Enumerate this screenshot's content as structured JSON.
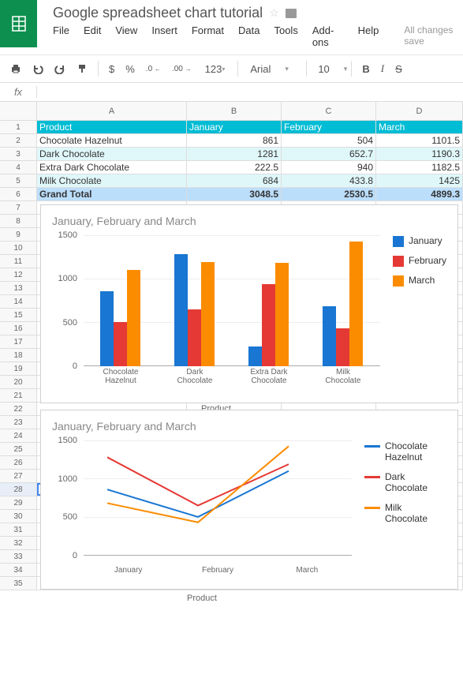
{
  "doc": {
    "title": "Google spreadsheet chart tutorial"
  },
  "menubar": {
    "file": "File",
    "edit": "Edit",
    "view": "View",
    "insert": "Insert",
    "format": "Format",
    "data": "Data",
    "tools": "Tools",
    "addons": "Add-ons",
    "help": "Help",
    "saved": "All changes save"
  },
  "toolbar": {
    "currency": "$",
    "percent": "%",
    "dec_down": ".0",
    "dec_up": ".00",
    "more_formats": "123",
    "font": "Arial",
    "font_size": "10",
    "bold": "B",
    "italic": "I",
    "strike": "S"
  },
  "columns": [
    "A",
    "B",
    "C",
    "D"
  ],
  "table": {
    "headers": [
      "Product",
      "January",
      "February",
      "March"
    ],
    "rows": [
      {
        "label": "Chocolate Hazelnut",
        "v": [
          861,
          504,
          1101.5
        ]
      },
      {
        "label": "Dark Chocolate",
        "v": [
          1281,
          652.7,
          1190.3
        ]
      },
      {
        "label": "Extra Dark Chocolate",
        "v": [
          222.5,
          940,
          1182.5
        ]
      },
      {
        "label": "Milk Chocolate",
        "v": [
          684,
          433.8,
          1425
        ]
      },
      {
        "label": "Grand Total",
        "v": [
          3048.5,
          2530.5,
          4899.3
        ]
      }
    ]
  },
  "chart_data": [
    {
      "type": "bar",
      "title": "January, February and March",
      "xlabel": "Product",
      "ylabel": "",
      "ylim": [
        0,
        1500
      ],
      "yticks": [
        0,
        500,
        1000,
        1500
      ],
      "categories": [
        "Chocolate Hazelnut",
        "Dark Chocolate",
        "Extra Dark Chocolate",
        "Milk Chocolate"
      ],
      "series": [
        {
          "name": "January",
          "color": "#1976d2",
          "values": [
            861,
            1281,
            222.5,
            684
          ]
        },
        {
          "name": "February",
          "color": "#e53935",
          "values": [
            504,
            652.7,
            940,
            433.8
          ]
        },
        {
          "name": "March",
          "color": "#fb8c00",
          "values": [
            1101.5,
            1190.3,
            1182.5,
            1425
          ]
        }
      ]
    },
    {
      "type": "line",
      "title": "January, February and March",
      "xlabel": "Product",
      "ylabel": "",
      "ylim": [
        0,
        1500
      ],
      "yticks": [
        0,
        500,
        1000,
        1500
      ],
      "categories": [
        "January",
        "February",
        "March"
      ],
      "series": [
        {
          "name": "Chocolate Hazelnut",
          "color": "#1976d2",
          "values": [
            861,
            504,
            1101.5
          ]
        },
        {
          "name": "Dark Chocolate",
          "color": "#e53935",
          "values": [
            1281,
            652.7,
            1190.3
          ]
        },
        {
          "name": "Milk Chocolate",
          "color": "#fb8c00",
          "values": [
            684,
            433.8,
            1425
          ]
        }
      ]
    }
  ]
}
